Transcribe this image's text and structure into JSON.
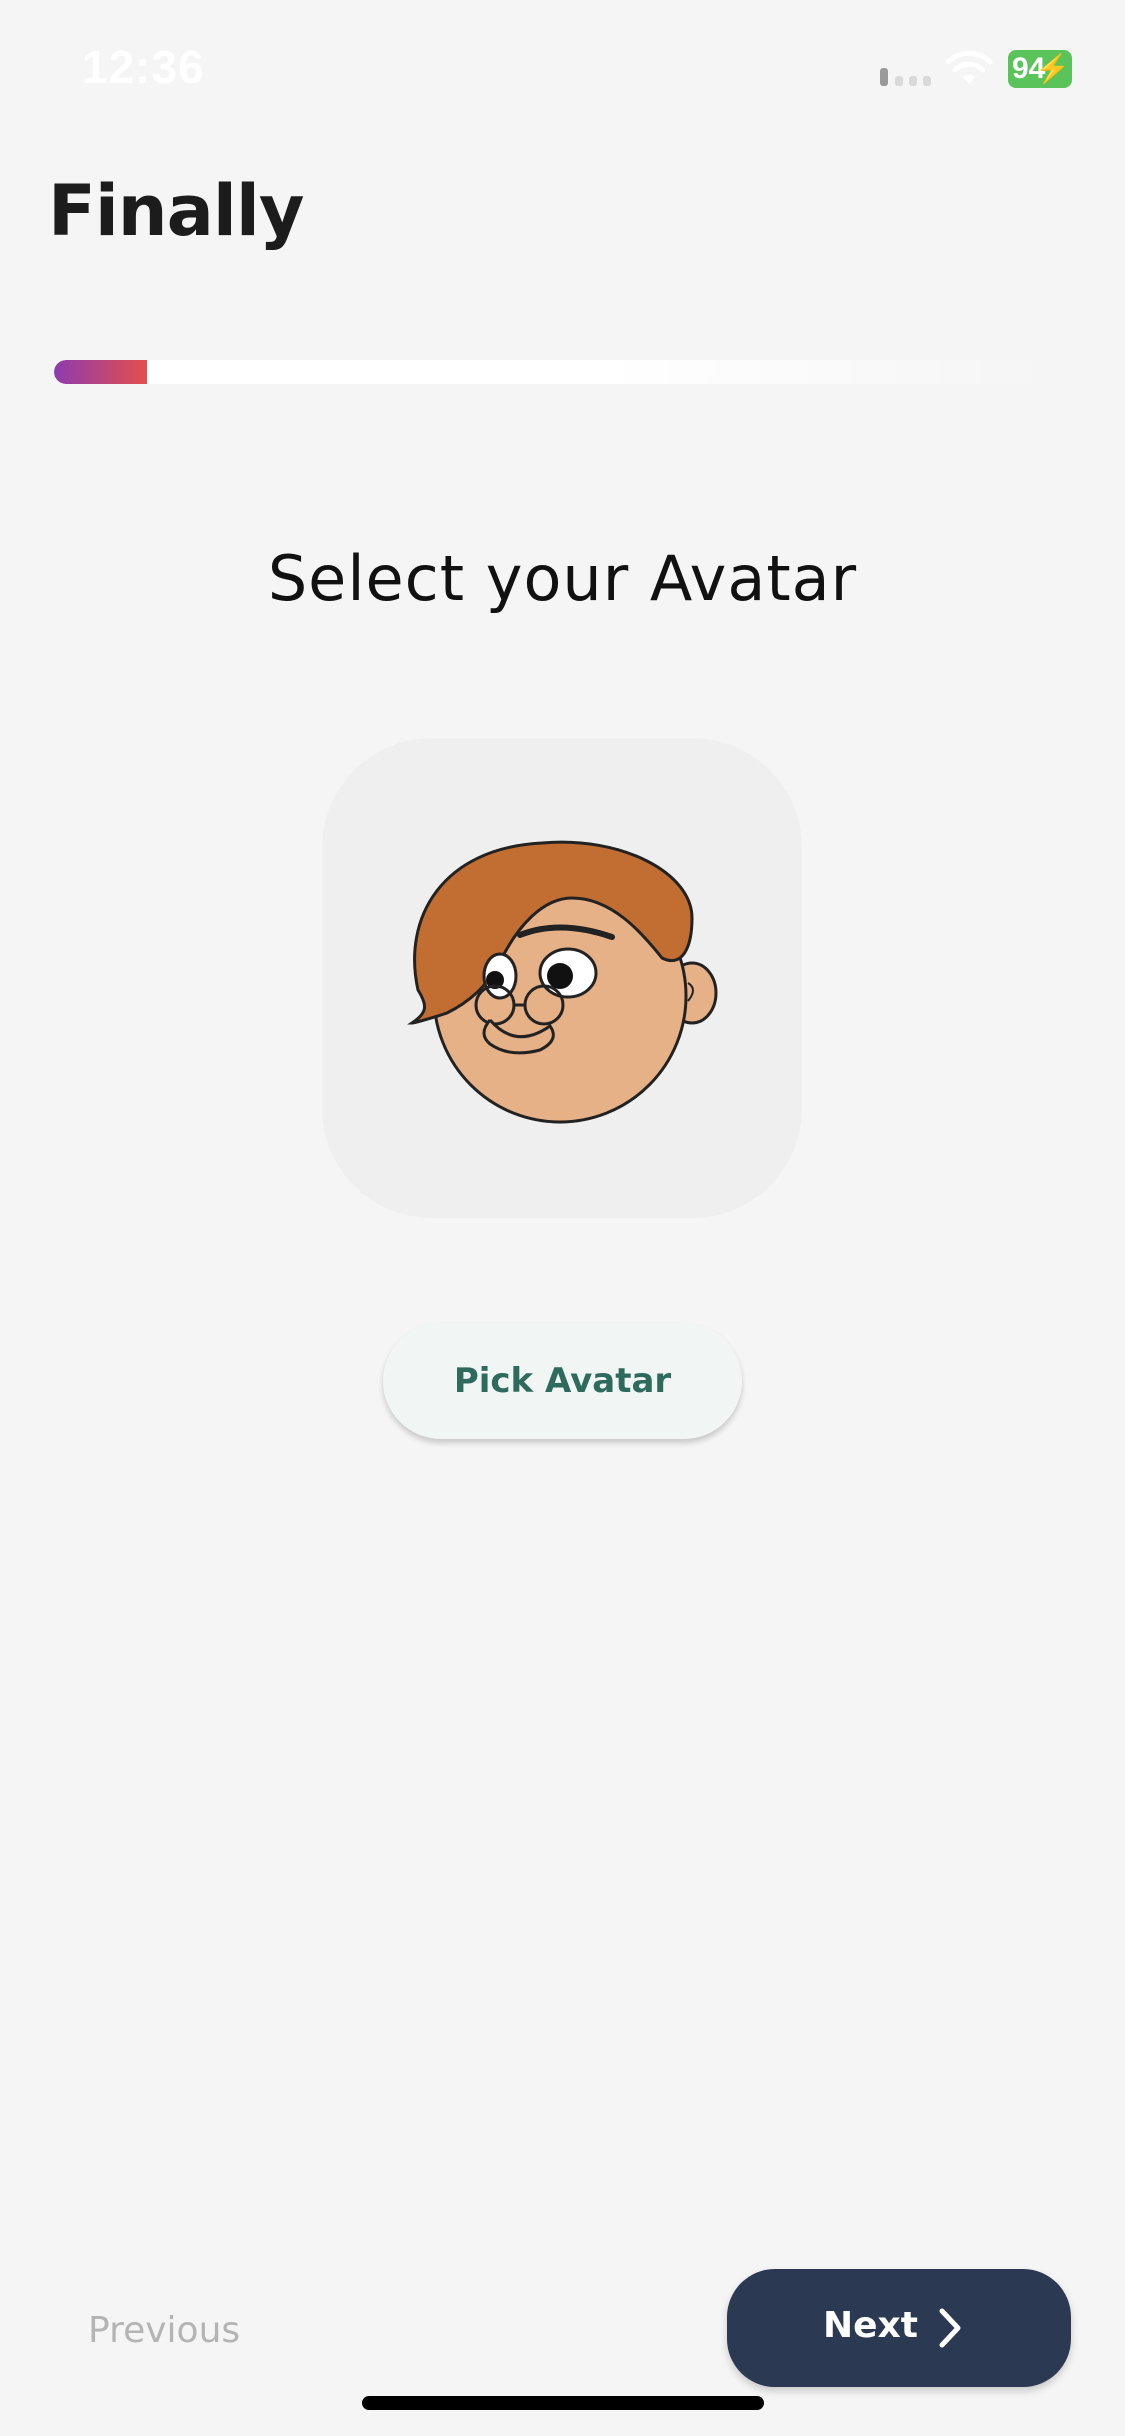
{
  "status_bar": {
    "time": "12:36",
    "battery": "94"
  },
  "header": {
    "title": "Finally"
  },
  "progress": {
    "fraction": 0.093
  },
  "main": {
    "heading": "Select your Avatar",
    "pick_button_label": "Pick Avatar"
  },
  "navigation": {
    "previous_label": "Previous",
    "next_label": "Next"
  },
  "colors": {
    "background": "#f5f5f5",
    "progress_start": "#8e3bb0",
    "progress_end": "#e2504a",
    "next_button": "#2b3a52",
    "pick_text": "#2f6b5d",
    "battery": "#5ac35a"
  },
  "icons": {
    "signal": "cellular-signal-icon",
    "wifi": "wifi-icon",
    "battery": "battery-charging-icon",
    "next": "chevron-right-icon",
    "avatar": "cartoon-face-avatar"
  }
}
